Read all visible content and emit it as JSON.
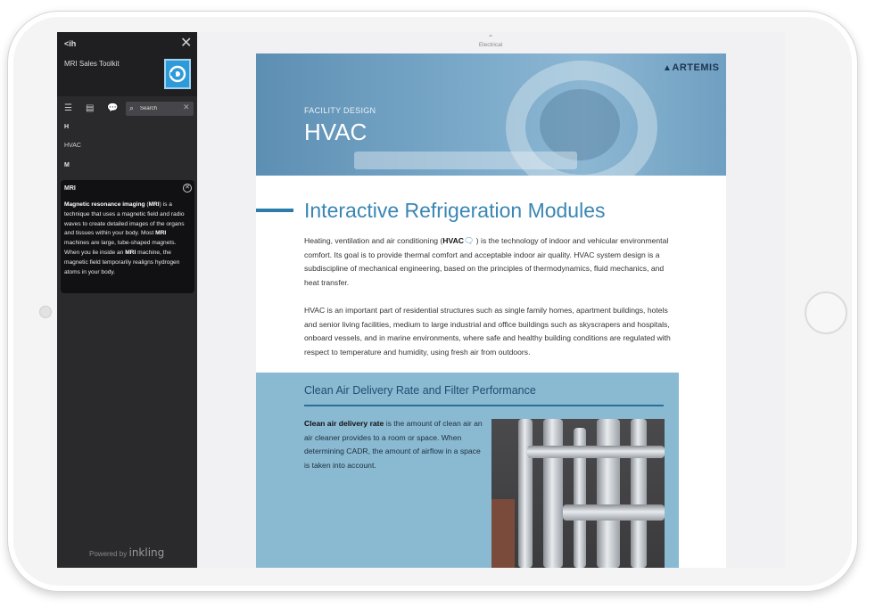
{
  "sidebar": {
    "logo": "<ih",
    "kit_title": "MRI Sales Toolkit",
    "search": {
      "placeholder": "Search"
    },
    "glossary": [
      {
        "type": "head",
        "label": "H"
      },
      {
        "type": "item",
        "label": "HVAC"
      },
      {
        "type": "head",
        "label": "M"
      }
    ],
    "definition": {
      "term": "MRI",
      "body_parts": [
        {
          "text": "Magnetic resonance imaging",
          "bold": true
        },
        {
          "text": " (",
          "bold": false
        },
        {
          "text": "MRI",
          "bold": true
        },
        {
          "text": ") is a technique that uses a magnetic field and radio waves to create detailed images of the organs and tissues within your body. Most ",
          "bold": false
        },
        {
          "text": "MRI",
          "bold": true
        },
        {
          "text": " machines are large, tube-shaped magnets. When you lie inside an ",
          "bold": false
        },
        {
          "text": "MRI",
          "bold": true
        },
        {
          "text": " machine, the magnetic field temporarily realigns hydrogen atoms in your body.",
          "bold": false
        }
      ]
    },
    "powered_by": "Powered by",
    "powered_brand": "inkling"
  },
  "content": {
    "breadcrumb": "Electrical",
    "brand": "ARTEMIS",
    "hero_kicker": "FACILITY DESIGN",
    "hero_title": "HVAC",
    "heading": "Interactive Refrigeration Modules",
    "para1_parts": [
      {
        "text": "Heating, ventilation and air conditioning (",
        "bold": false
      },
      {
        "text": "HVAC",
        "bold": true
      },
      {
        "text": " ) is the technology of indoor and vehicular environmental comfort. Its goal is to provide thermal comfort and acceptable indoor air quality. HVAC system design is a subdiscipline of mechanical engineering, based on the principles of thermodynamics, fluid mechanics, and heat transfer.",
        "bold": false
      }
    ],
    "para2": "HVAC is an important part of residential structures such as single family homes, apartment buildings, hotels and senior living facilities, medium to large industrial and office buildings such as skyscrapers and hospitals, onboard vessels, and in marine environments, where safe and healthy building conditions are regulated with respect to temperature and humidity, using fresh air from outdoors.",
    "callout": {
      "title": "Clean Air Delivery Rate and Filter Performance",
      "bold_lead": "Clean air delivery rate",
      "text": " is the amount of clean air an air cleaner provides to a room or space. When determining CADR, the amount of airflow in a space is taken into account."
    }
  },
  "colors": {
    "accent": "#3a86b3",
    "sidebar_bg": "#2a2a2c",
    "callout_bg": "#8ab9d2"
  }
}
